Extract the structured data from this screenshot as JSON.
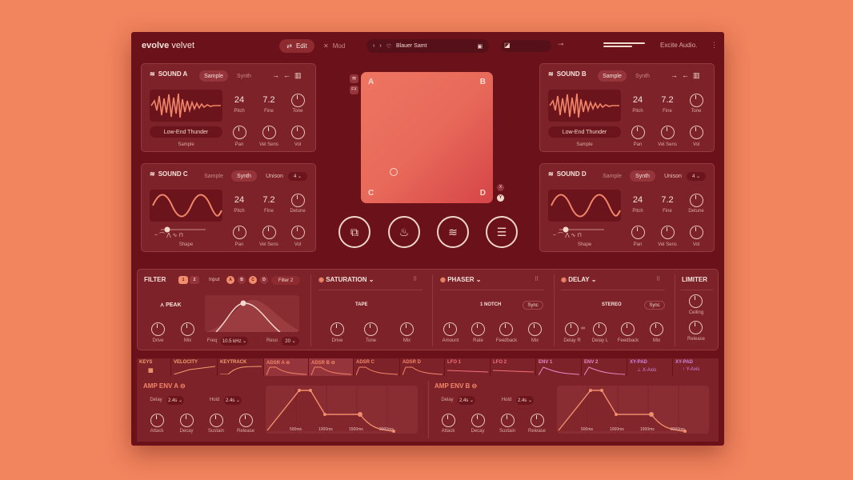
{
  "app": {
    "brand_bold": "evolve",
    "brand_light": "velvet",
    "company": "Excite Audio."
  },
  "topbar": {
    "edit_label": "Edit",
    "mod_label": "Mod",
    "preset_name": "Blauer Samt"
  },
  "sound_a": {
    "title": "SOUND A",
    "tab_sample": "Sample",
    "tab_synth": "Synth",
    "pitch": "24",
    "fine": "7.2",
    "sample_name": "Low-End Thunder",
    "labels": {
      "pitch": "Pitch",
      "fine": "Fine",
      "tone": "Tone",
      "sample": "Sample",
      "pan": "Pan",
      "vel": "Vel Sens",
      "vol": "Vol"
    }
  },
  "sound_b": {
    "title": "SOUND B",
    "tab_sample": "Sample",
    "tab_synth": "Synth",
    "pitch": "24",
    "fine": "7.2",
    "sample_name": "Low-End Thunder",
    "labels": {
      "pitch": "Pitch",
      "fine": "Fine",
      "tone": "Tone",
      "sample": "Sample",
      "pan": "Pan",
      "vel": "Vel Sens",
      "vol": "Vol"
    }
  },
  "sound_c": {
    "title": "SOUND C",
    "tab_sample": "Sample",
    "tab_synth": "Synth",
    "unison_label": "Unison",
    "unison_val": "4",
    "pitch": "24",
    "fine": "7.2",
    "labels": {
      "pitch": "Pitch",
      "fine": "Fine",
      "detune": "Detune",
      "shape": "Shape",
      "pan": "Pan",
      "vel": "Vel Sens",
      "vol": "Vol"
    }
  },
  "sound_d": {
    "title": "SOUND D",
    "tab_sample": "Sample",
    "tab_synth": "Synth",
    "unison_label": "Unison",
    "unison_val": "4",
    "pitch": "24",
    "fine": "7.2",
    "labels": {
      "pitch": "Pitch",
      "fine": "Fine",
      "detune": "Detune",
      "shape": "Shape",
      "pan": "Pan",
      "vel": "Vel Sens",
      "vol": "Vol"
    }
  },
  "xy": {
    "a": "A",
    "b": "B",
    "c": "C",
    "d": "D",
    "x": "X",
    "y": "Y",
    "fx": "FX"
  },
  "filter": {
    "title": "FILTER",
    "slot1": "1",
    "slot2": "2",
    "input_label": "Input",
    "inputs": [
      "A",
      "B",
      "C",
      "D"
    ],
    "filter_sel": "Filter 2",
    "type": "PEAK",
    "freq_label": "Freq",
    "freq_val": "10.5 kHz",
    "reso_label": "Reso",
    "reso_val": "20",
    "drive": "Drive",
    "mix": "Mix"
  },
  "saturation": {
    "title": "SATURATION",
    "mode": "TAPE",
    "drive": "Drive",
    "tone": "Tone",
    "mix": "Mix"
  },
  "phaser": {
    "title": "PHASER",
    "mode": "1 NOTCH",
    "sync": "Sync",
    "amount": "Amount",
    "rate": "Rate",
    "feedback": "Feedback",
    "mix": "Mix"
  },
  "delay": {
    "title": "DELAY",
    "mode": "STEREO",
    "sync": "Sync",
    "delay_r": "Delay R",
    "delay_l": "Delay L",
    "feedback": "Feedback",
    "mix": "Mix"
  },
  "limiter": {
    "title": "LIMITER",
    "ceiling": "Ceiling",
    "release": "Release"
  },
  "mod_tabs": [
    "KEYS",
    "VELOCITY",
    "KEYTRACK",
    "ADSR A",
    "ADSR B",
    "ADSR C",
    "ADSR D",
    "LFO 1",
    "LFO 2",
    "ENV 1",
    "ENV 2",
    "XY-PAD",
    "XY-PAD"
  ],
  "xy_axis": {
    "x": "X-Axis",
    "y": "Y-Axis"
  },
  "env_a": {
    "title": "AMP ENV A",
    "delay_label": "Delay",
    "delay_val": "2.4s",
    "hold_label": "Hold",
    "hold_val": "2.4s",
    "attack": "Attack",
    "decay": "Decay",
    "sustain": "Sustain",
    "release": "Release",
    "ticks": [
      "500ms",
      "1000ms",
      "1500ms",
      "2000ms"
    ]
  },
  "env_b": {
    "title": "AMP ENV B",
    "delay_label": "Delay",
    "delay_val": "2.4s",
    "hold_label": "Hold",
    "hold_val": "2.4s",
    "attack": "Attack",
    "decay": "Decay",
    "sustain": "Sustain",
    "release": "Release",
    "ticks": [
      "500ms",
      "1000ms",
      "1500ms",
      "2000ms"
    ]
  }
}
